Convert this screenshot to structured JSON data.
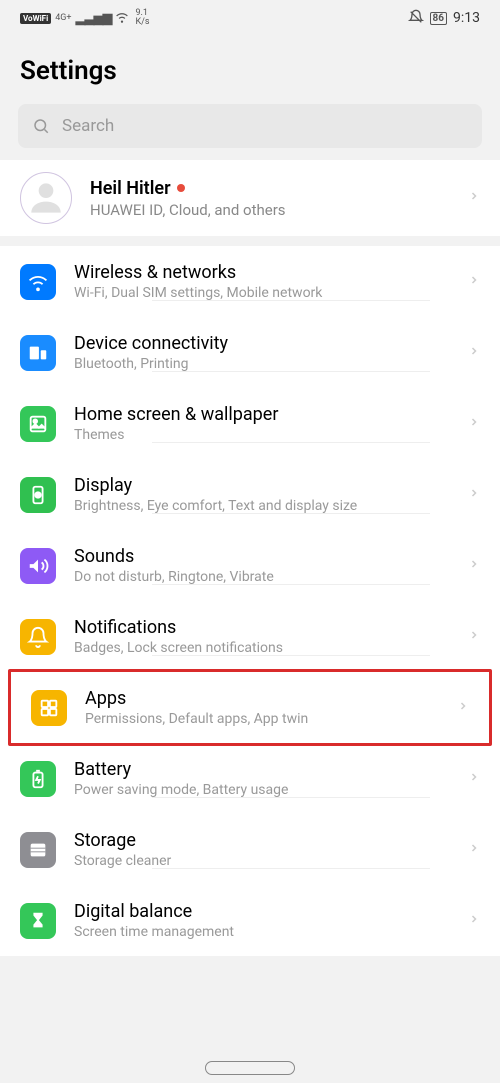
{
  "status": {
    "vowifi": "VoWiFi",
    "net_label": "4G+",
    "speed_top": "9.1",
    "speed_bottom": "K/s",
    "battery": "86",
    "time": "9:13"
  },
  "header": {
    "title": "Settings"
  },
  "search": {
    "placeholder": "Search"
  },
  "profile": {
    "name": "Heil Hitler",
    "sub": "HUAWEI ID, Cloud, and others"
  },
  "items": [
    {
      "title": "Wireless & networks",
      "sub": "Wi-Fi, Dual SIM settings, Mobile network",
      "color": "ic-blue",
      "icon": "wifi"
    },
    {
      "title": "Device connectivity",
      "sub": "Bluetooth, Printing",
      "color": "ic-blue2",
      "icon": "devices"
    },
    {
      "title": "Home screen & wallpaper",
      "sub": "Themes",
      "color": "ic-green",
      "icon": "wallpaper"
    },
    {
      "title": "Display",
      "sub": "Brightness, Eye comfort, Text and display size",
      "color": "ic-green2",
      "icon": "display"
    },
    {
      "title": "Sounds",
      "sub": "Do not disturb, Ringtone, Vibrate",
      "color": "ic-purple",
      "icon": "sound"
    },
    {
      "title": "Notifications",
      "sub": "Badges, Lock screen notifications",
      "color": "ic-yellow",
      "icon": "bell"
    },
    {
      "title": "Apps",
      "sub": "Permissions, Default apps, App twin",
      "color": "ic-yellow",
      "icon": "apps",
      "highlighted": true
    },
    {
      "title": "Battery",
      "sub": "Power saving mode, Battery usage",
      "color": "ic-green",
      "icon": "battery"
    },
    {
      "title": "Storage",
      "sub": "Storage cleaner",
      "color": "ic-gray",
      "icon": "storage"
    },
    {
      "title": "Digital balance",
      "sub": "Screen time management",
      "color": "ic-green",
      "icon": "hourglass"
    }
  ]
}
